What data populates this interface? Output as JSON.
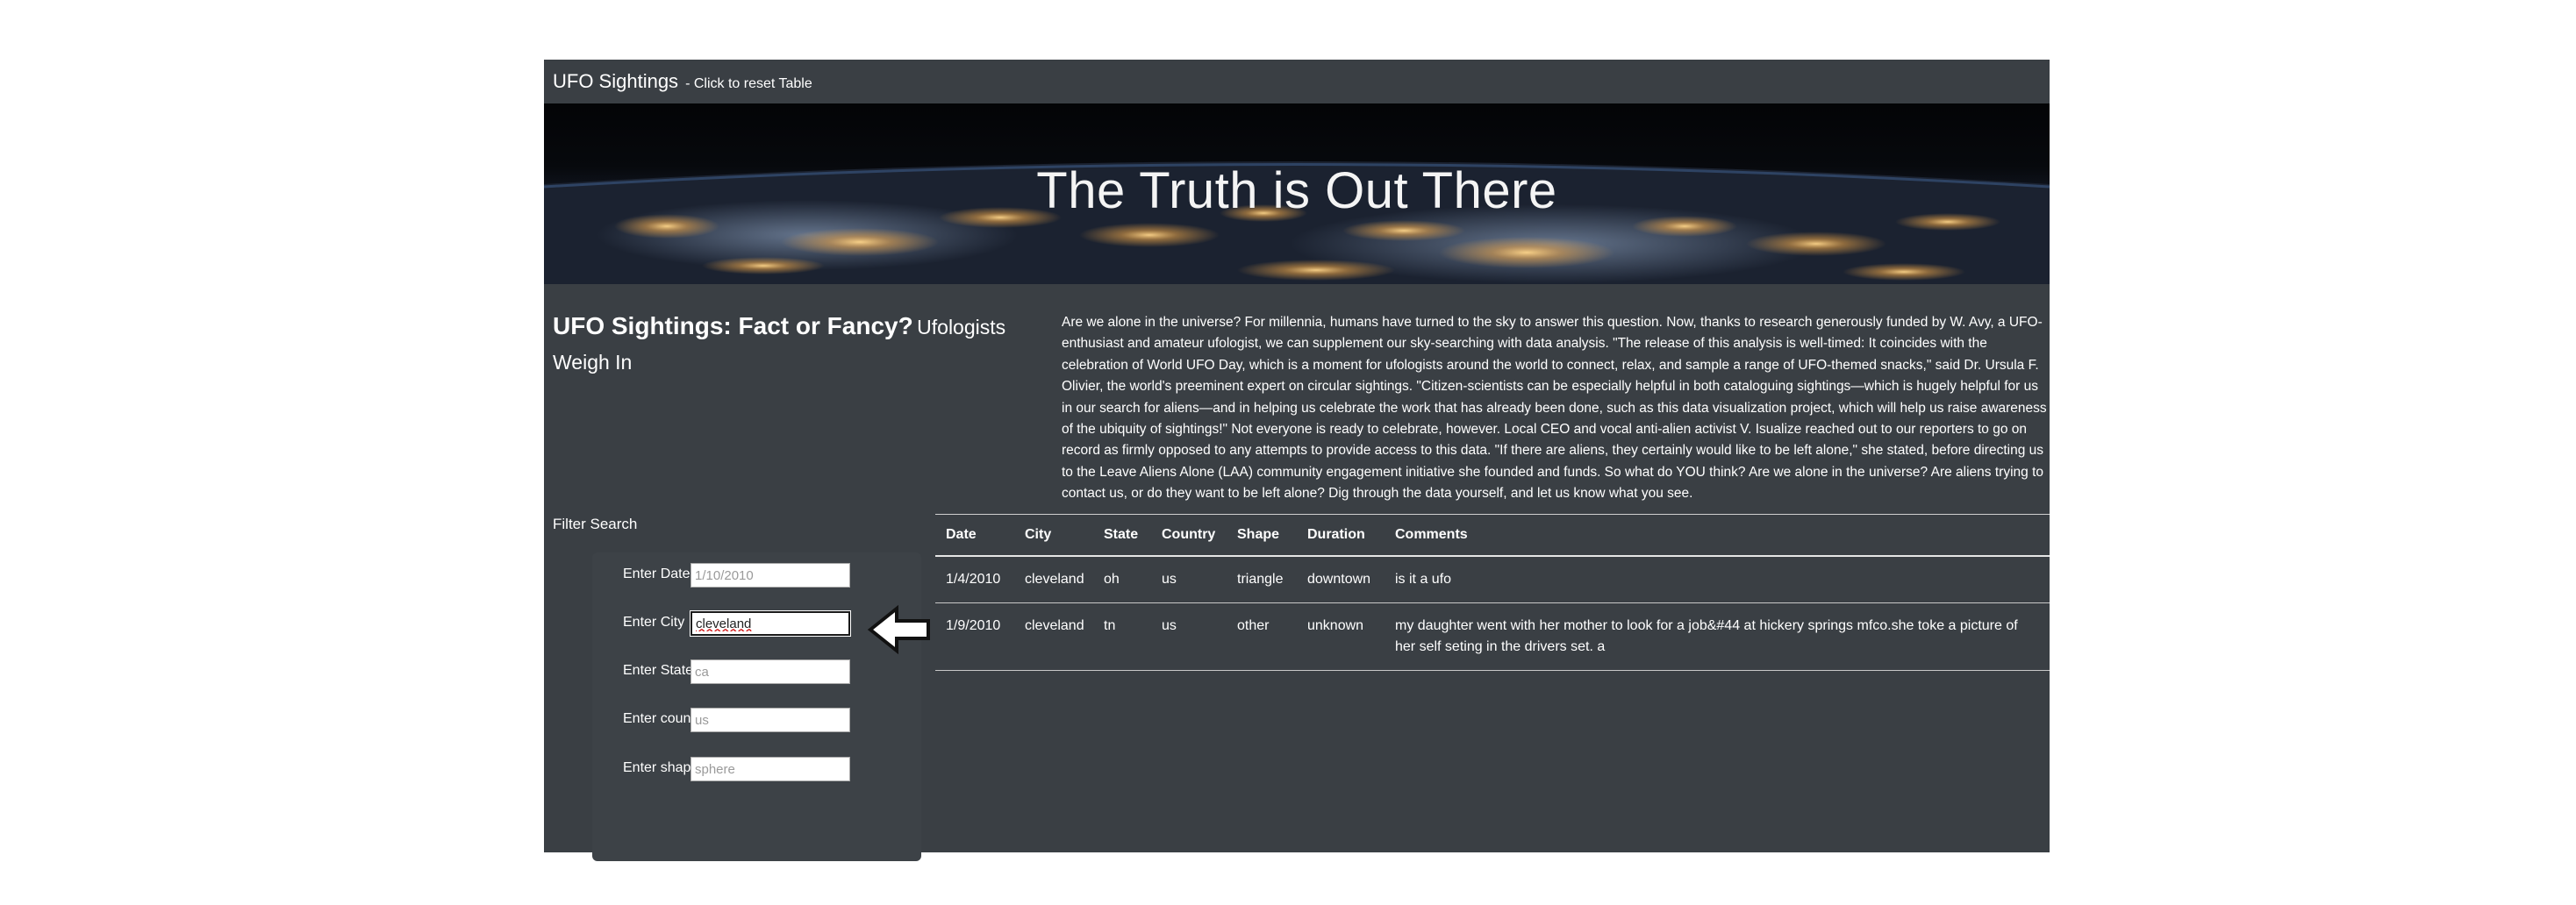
{
  "navbar": {
    "title": "UFO Sightings",
    "subtitle": "- Click to reset Table"
  },
  "hero": {
    "title": "The Truth is Out There"
  },
  "headline": {
    "main": "UFO Sightings: Fact or Fancy?",
    "sub": "Ufologists Weigh In"
  },
  "article": {
    "text": "Are we alone in the universe? For millennia, humans have turned to the sky to answer this question. Now, thanks to research generously funded by W. Avy, a UFO-enthusiast and amateur ufologist, we can supplement our sky-searching with data analysis. \"The release of this analysis is well-timed: It coincides with the celebration of World UFO Day, which is a moment for ufologists around the world to connect, relax, and sample a range of UFO-themed snacks,\" said Dr. Ursula F. Olivier, the world's preeminent expert on circular sightings. \"Citizen-scientists can be especially helpful in both cataloguing sightings—which is hugely helpful for us in our search for aliens—and in helping us celebrate the work that has already been done, such as this data visualization project, which will help us raise awareness of the ubiquity of sightings!\" Not everyone is ready to celebrate, however. Local CEO and vocal anti-alien activist V. Isualize reached out to our reporters to go on record as firmly opposed to any attempts to provide access to this data. \"If there are aliens, they certainly would like to be left alone,\" she stated, before directing us to the Leave Aliens Alone (LAA) community engagement initiative she founded and funds. So what do YOU think? Are we alone in the universe? Are aliens trying to contact us, or do they want to be left alone? Dig through the data yourself, and let us know what you see."
  },
  "filters": {
    "title": "Filter Search",
    "date": {
      "label": "Enter Date",
      "placeholder": "1/10/2010",
      "value": ""
    },
    "city": {
      "label": "Enter City",
      "placeholder": "",
      "value": "cleveland"
    },
    "state": {
      "label": "Enter State",
      "placeholder": "ca",
      "value": ""
    },
    "country": {
      "label": "Enter country",
      "placeholder": "us",
      "value": ""
    },
    "shape": {
      "label": "Enter shape",
      "placeholder": "sphere",
      "value": ""
    }
  },
  "table": {
    "headers": {
      "date": "Date",
      "city": "City",
      "state": "State",
      "country": "Country",
      "shape": "Shape",
      "duration": "Duration",
      "comments": "Comments"
    },
    "rows": [
      {
        "date": "1/4/2010",
        "city": "cleveland",
        "state": "oh",
        "country": "us",
        "shape": "triangle",
        "duration": "downtown",
        "comments": "is it a ufo"
      },
      {
        "date": "1/9/2010",
        "city": "cleveland",
        "state": "tn",
        "country": "us",
        "shape": "other",
        "duration": "unknown",
        "comments": "my daughter went with her mother to look for a job&#44 at hickery springs mfco.she toke a picture of her self seting in the drivers set. a"
      }
    ]
  }
}
